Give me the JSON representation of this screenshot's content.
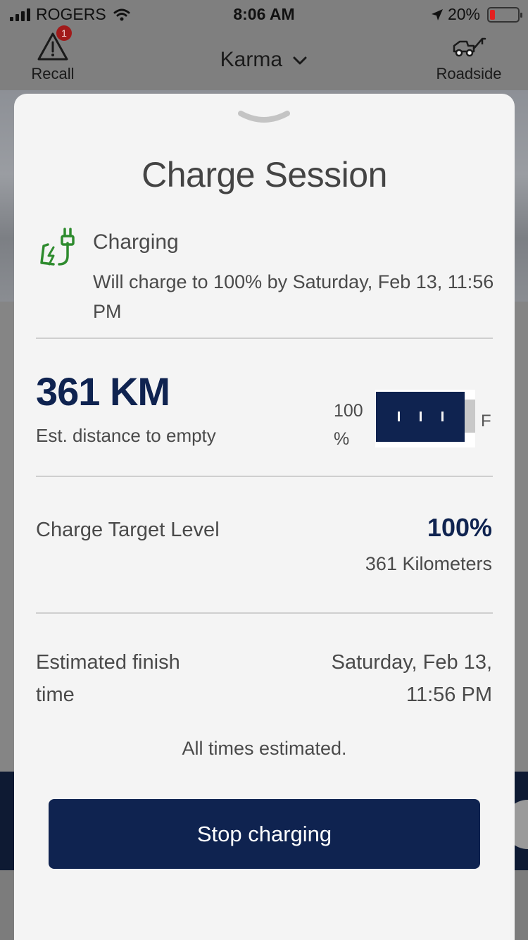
{
  "status_bar": {
    "carrier": "ROGERS",
    "time": "8:06 AM",
    "battery_percent": "20%",
    "icons": [
      "signal-icon",
      "wifi-icon",
      "location-arrow-icon",
      "battery-icon"
    ]
  },
  "top_nav": {
    "recall_label": "Recall",
    "recall_badge": "1",
    "vehicle_name": "Karma",
    "roadside_label": "Roadside",
    "icons": [
      "warning-triangle-icon",
      "chevron-down-icon",
      "tow-truck-icon"
    ]
  },
  "sheet": {
    "title": "Charge Session",
    "status_title": "Charging",
    "status_message": "Will charge to 100% by Saturday, Feb 13, 11:56 PM",
    "range_value": "361 KM",
    "range_label": "Est. distance to empty",
    "battery_percent_line1": "100",
    "battery_percent_line2": "%",
    "battery_level": 1.0,
    "full_label": "F",
    "target_label": "Charge Target Level",
    "target_value": "100%",
    "target_distance": "361 Kilometers",
    "finish_label": "Estimated finish time",
    "finish_value_line1": "Saturday, Feb 13,",
    "finish_value_line2": "11:56 PM",
    "note": "All times estimated.",
    "stop_button": "Stop charging"
  },
  "colors": {
    "navy": "#0f2350",
    "charging_green": "#2e8b2e",
    "sheet_bg": "#f4f4f4"
  }
}
